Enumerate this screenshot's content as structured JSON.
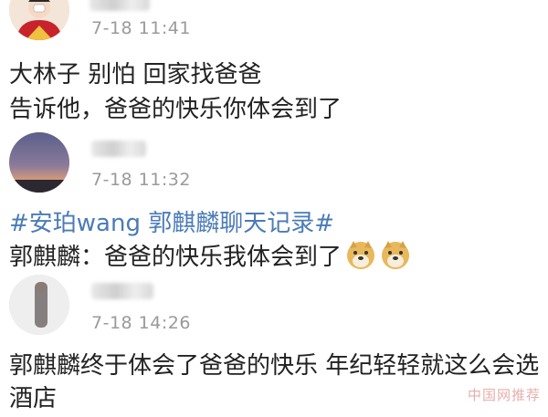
{
  "posts": [
    {
      "timestamp": "7-18 11:41",
      "lines": [
        "大林子 别怕 回家找爸爸",
        "告诉他，爸爸的快乐你体会到了"
      ]
    },
    {
      "timestamp": "7-18 11:32",
      "hashtag": "#安珀wang 郭麒麟聊天记录#",
      "quote": "郭麒麟：爸爸的快乐我体会到了",
      "emoji": "doge-icon"
    },
    {
      "timestamp": "7-18 14:26",
      "lines": [
        "郭麒麟终于体会了爸爸的快乐 年纪轻轻就这么会选",
        "酒店"
      ]
    }
  ],
  "watermark": "中国网推荐",
  "colors": {
    "hashtag": "#4a7bb8",
    "timestamp": "#9a9a9a",
    "text": "#222222"
  }
}
